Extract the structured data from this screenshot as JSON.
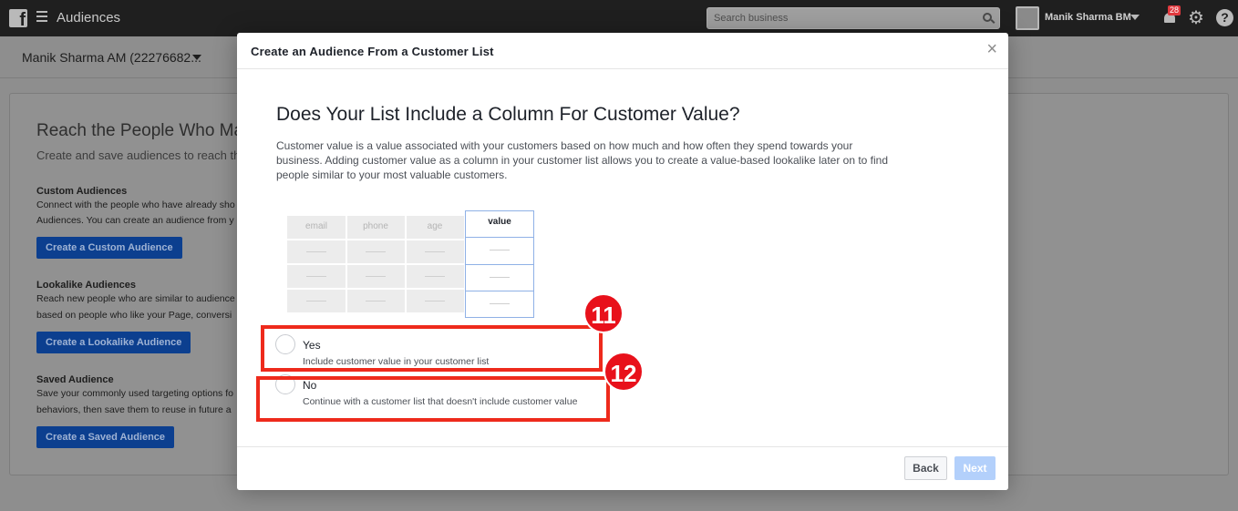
{
  "topbar": {
    "app_title": "Audiences",
    "search_placeholder": "Search business",
    "business_name": "Manik Sharma BM",
    "notification_count": "28"
  },
  "subbar": {
    "account_name": "Manik Sharma AM (22276682..."
  },
  "background": {
    "heading": "Reach the People Who Mat",
    "subheading": "Create and save audiences to reach the",
    "sections": [
      {
        "title": "Custom Audiences",
        "lines": [
          "Connect with the people who have already sho",
          "Audiences. You can create an audience from y"
        ],
        "button": "Create a Custom Audience"
      },
      {
        "title": "Lookalike Audiences",
        "lines": [
          "Reach new people who are similar to audience",
          "based on people who like your Page, conversi"
        ],
        "button": "Create a Lookalike Audience"
      },
      {
        "title": "Saved Audience",
        "lines": [
          "Save your commonly used targeting options fo",
          "behaviors, then save them to reuse in future a"
        ],
        "button": "Create a Saved Audience"
      }
    ]
  },
  "modal": {
    "title": "Create an Audience From a Customer List",
    "close": "×",
    "question": "Does Your List Include a Column For Customer Value?",
    "description": "Customer value is a value associated with your customers based on how much and how often they spend towards your business. Adding customer value as a column in your customer list allows you to create a value-based lookalike later on to find people similar to your most valuable customers.",
    "illustration": {
      "columns": [
        "email",
        "phone",
        "age"
      ],
      "value_column": "value"
    },
    "options": [
      {
        "label": "Yes",
        "description": "Include customer value in your customer list",
        "step": "11"
      },
      {
        "label": "No",
        "description": "Continue with a customer list that doesn't include customer value",
        "step": "12"
      }
    ],
    "back_button": "Back",
    "next_button": "Next"
  },
  "colors": {
    "highlight": "#ee2a1c",
    "badge": "#e8111b",
    "primary_disabled": "#b3d0fb"
  }
}
